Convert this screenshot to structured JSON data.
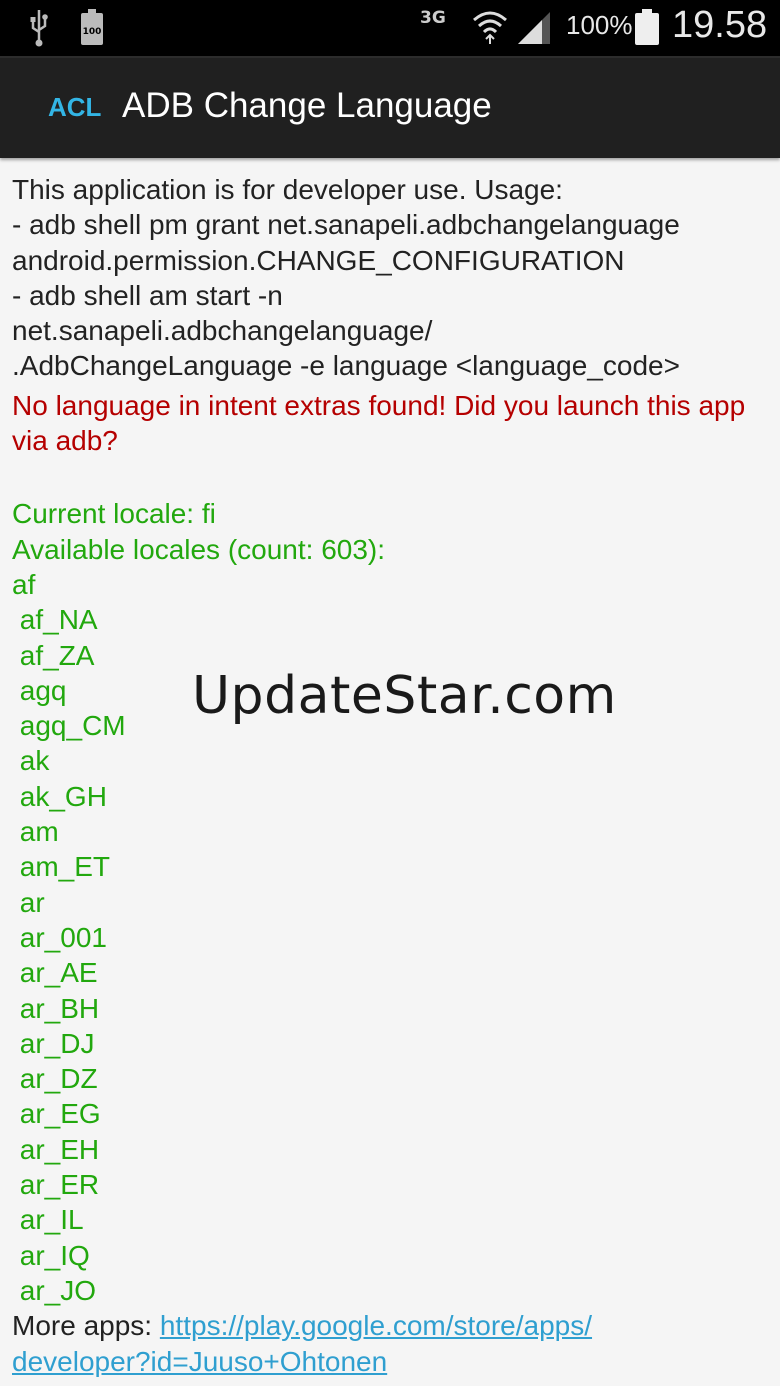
{
  "status_bar": {
    "network_type": "3G",
    "battery_small_label": "100",
    "battery_percent": "100%",
    "time": "19.58",
    "icons": [
      "usb-icon",
      "battery-saver-icon",
      "data-3g-icon",
      "wifi-icon",
      "signal-icon",
      "battery-icon"
    ]
  },
  "action_bar": {
    "logo_text": "ACL",
    "title": "ADB Change Language"
  },
  "usage": {
    "lines": [
      "This application is for developer use. Usage:",
      "- adb shell pm grant net.sanapeli.adbchangelanguage",
      "android.permission.CHANGE_CONFIGURATION",
      "- adb shell am start -n",
      "net.sanapeli.adbchangelanguage/",
      ".AdbChangeLanguage -e language <language_code>"
    ]
  },
  "error": {
    "message": "No language in intent extras found! Did you launch this app via adb?"
  },
  "locale_info": {
    "current": "Current locale: fi",
    "available": "Available locales (count: 603):"
  },
  "locales": [
    "af",
    " af_NA",
    " af_ZA",
    " agq",
    " agq_CM",
    " ak",
    " ak_GH",
    " am",
    " am_ET",
    " ar",
    " ar_001",
    " ar_AE",
    " ar_BH",
    " ar_DJ",
    " ar_DZ",
    " ar_EG",
    " ar_EH",
    " ar_ER",
    " ar_IL",
    " ar_IQ",
    " ar_JO"
  ],
  "footer": {
    "label": "More apps: ",
    "link_line1": "https://play.google.com/store/apps/",
    "link_line2": "developer?id=Juuso+Ohtonen"
  },
  "watermark": "UpdateStar.com",
  "colors": {
    "accent": "#33b5e5",
    "error": "#b50000",
    "success": "#22a80e",
    "link": "#2f9fd0"
  }
}
